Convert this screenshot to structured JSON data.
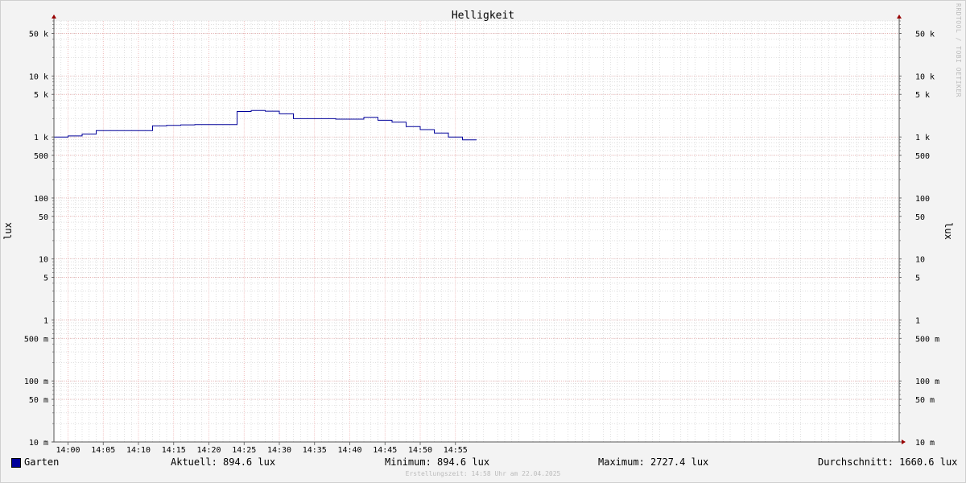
{
  "chart_data": {
    "type": "line",
    "title": "Helligkeit",
    "ylabel": "lux",
    "ylabel_right": "lux",
    "y_scale": "log",
    "ylim": [
      0.01,
      80000
    ],
    "xlim": [
      "13:58",
      "15:58"
    ],
    "x_ticks": [
      "14:00",
      "14:05",
      "14:10",
      "14:15",
      "14:20",
      "14:25",
      "14:30",
      "14:35",
      "14:40",
      "14:45",
      "14:50",
      "14:55"
    ],
    "y_ticks": [
      {
        "value": 0.01,
        "label": "10 m"
      },
      {
        "value": 0.05,
        "label": "50 m"
      },
      {
        "value": 0.1,
        "label": "100 m"
      },
      {
        "value": 0.5,
        "label": "500 m"
      },
      {
        "value": 1,
        "label": "1"
      },
      {
        "value": 5,
        "label": "5"
      },
      {
        "value": 10,
        "label": "10"
      },
      {
        "value": 50,
        "label": "50"
      },
      {
        "value": 100,
        "label": "100"
      },
      {
        "value": 500,
        "label": "500"
      },
      {
        "value": 1000,
        "label": "1 k"
      },
      {
        "value": 5000,
        "label": "5 k"
      },
      {
        "value": 10000,
        "label": "10 k"
      },
      {
        "value": 50000,
        "label": "50 k"
      }
    ],
    "grid": true,
    "legend_position": "bottom",
    "series": [
      {
        "name": "Garten",
        "color": "#000099",
        "step": "post",
        "x": [
          "13:58",
          "14:00",
          "14:02",
          "14:04",
          "14:06",
          "14:08",
          "14:10",
          "14:12",
          "14:14",
          "14:16",
          "14:18",
          "14:20",
          "14:22",
          "14:24",
          "14:26",
          "14:28",
          "14:30",
          "14:32",
          "14:34",
          "14:36",
          "14:38",
          "14:40",
          "14:42",
          "14:44",
          "14:46",
          "14:48",
          "14:50",
          "14:52",
          "14:54",
          "14:56",
          "14:58"
        ],
        "values": [
          1000,
          1040,
          1120,
          1270,
          1270,
          1270,
          1270,
          1520,
          1550,
          1580,
          1600,
          1600,
          1600,
          2620,
          2727.4,
          2650,
          2400,
          2000,
          2000,
          2000,
          1960,
          1960,
          2100,
          1880,
          1750,
          1480,
          1320,
          1160,
          1000,
          894.6,
          894.6
        ]
      }
    ]
  },
  "legend": {
    "series_name": "Garten",
    "current": "Aktuell: 894.6 lux",
    "minimum": "Minimum: 894.6 lux",
    "maximum": "Maximum: 2727.4 lux",
    "average": "Durchschnitt: 1660.6 lux"
  },
  "footer": "Erstellungszeit: 14:58 Uhr am 22.04.2025",
  "watermark": "RRDTOOL / TOBI OETIKER",
  "colors": {
    "background": "#f3f3f3",
    "plot_background": "#ffffff",
    "series": "#000099",
    "major_grid": "#e8a0a0",
    "minor_grid": "#cccccc",
    "axis": "#555555",
    "arrow": "#990000"
  }
}
